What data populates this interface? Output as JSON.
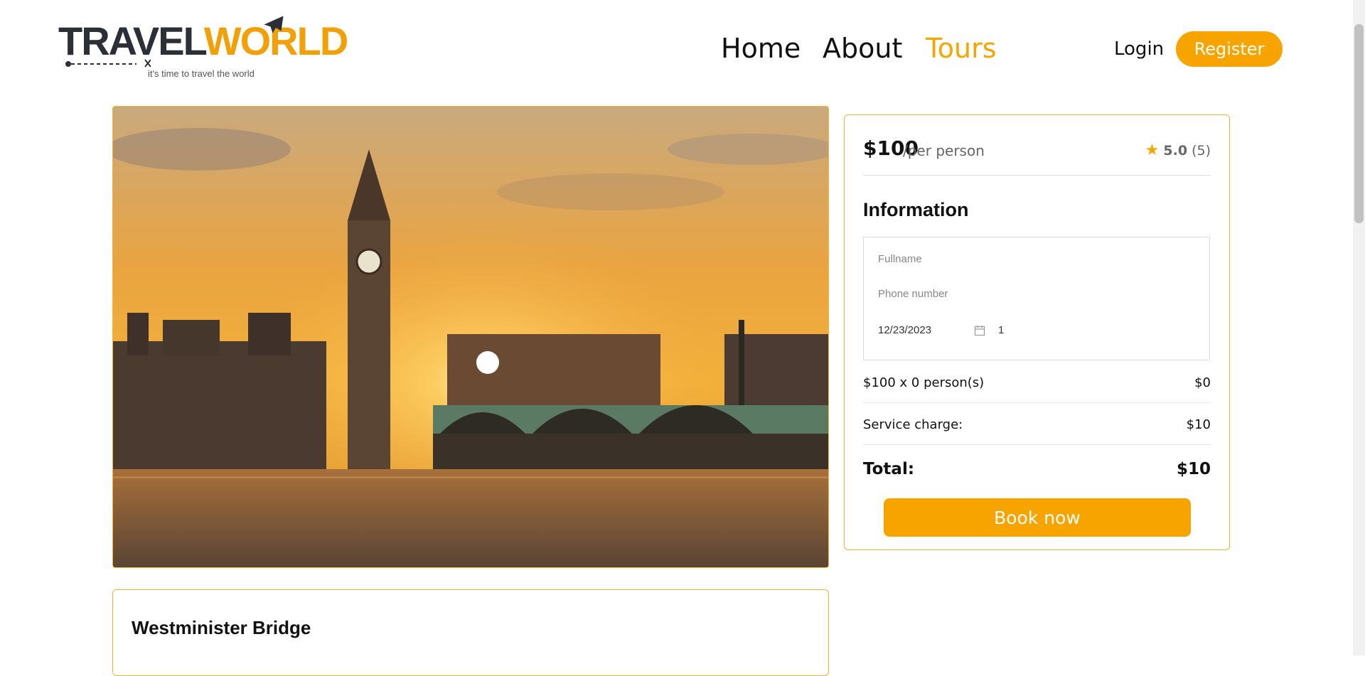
{
  "brand": {
    "name_part1": "TRAVEL",
    "name_part2": "WORLD",
    "tagline": "it's time to travel the world"
  },
  "nav": {
    "items": [
      {
        "label": "Home",
        "active": false
      },
      {
        "label": "About",
        "active": false
      },
      {
        "label": "Tours",
        "active": true
      }
    ],
    "login": "Login",
    "register": "Register"
  },
  "tour": {
    "title": "Westminister Bridge"
  },
  "booking": {
    "price": "$100",
    "per": "/per person",
    "rating": "5.0",
    "reviews": "(5)",
    "info_title": "Information",
    "fullname_placeholder": "Fullname",
    "phone_placeholder": "Phone number",
    "date_value": "12/23/2023",
    "guest_value": "1",
    "price_line_label": "$100 x 0 person(s)",
    "price_line_value": "$0",
    "service_label": "Service charge:",
    "service_value": "$10",
    "total_label": "Total:",
    "total_value": "$10",
    "book_label": "Book now"
  },
  "colors": {
    "accent": "#f7a400",
    "border": "#f2b233",
    "logo_dark": "#2b2f38"
  }
}
